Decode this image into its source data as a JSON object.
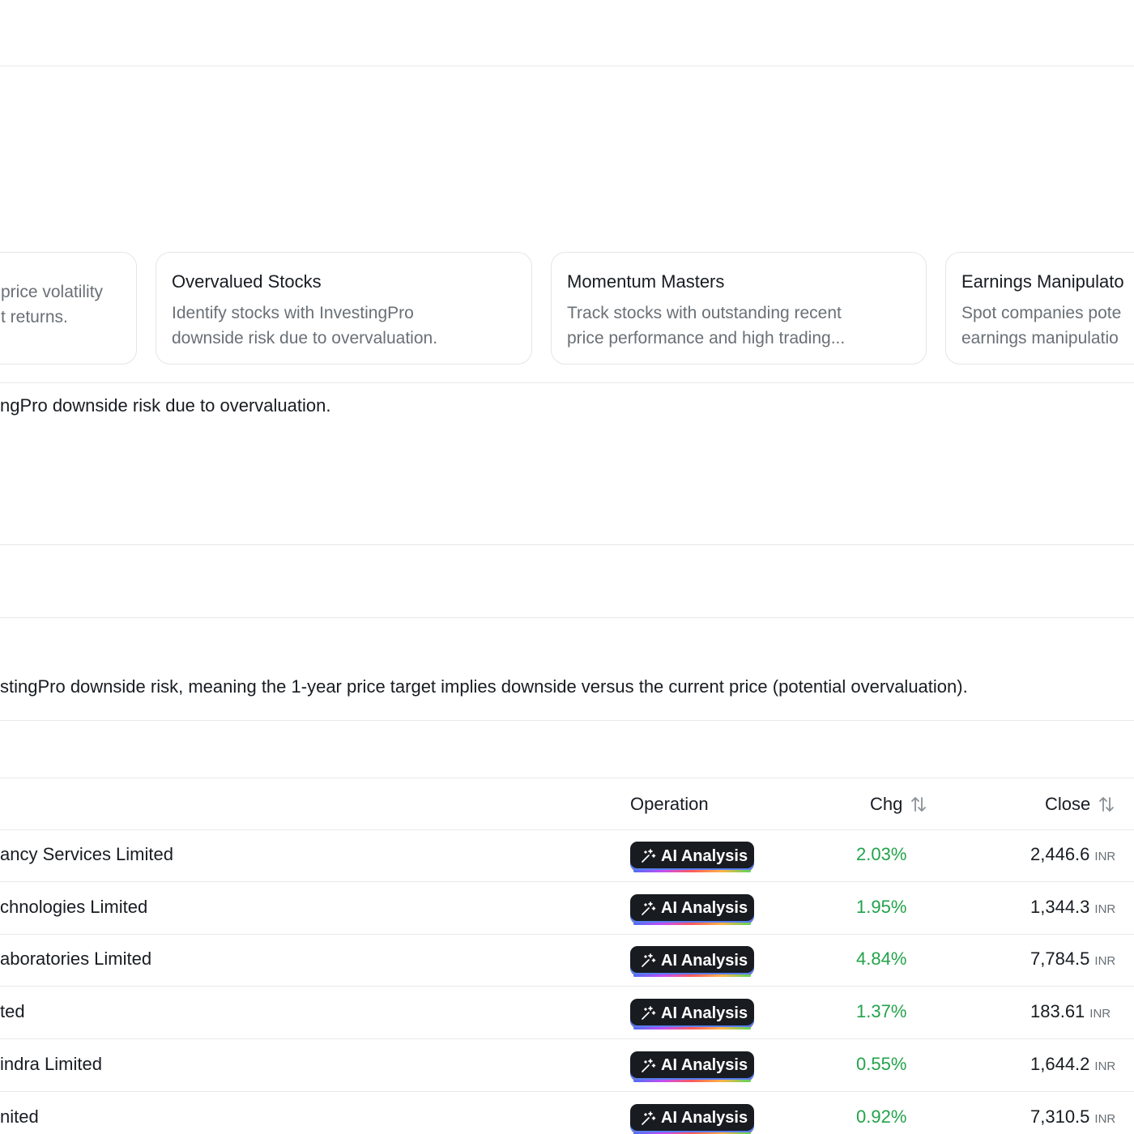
{
  "cards": [
    {
      "title": "",
      "desc_lines": [
        "price volatility",
        "t returns."
      ]
    },
    {
      "title": "Overvalued Stocks",
      "desc_lines": [
        "Identify stocks with InvestingPro",
        "downside risk due to overvaluation."
      ]
    },
    {
      "title": "Momentum Masters",
      "desc_lines": [
        "Track stocks with outstanding recent",
        "price performance and high trading..."
      ]
    },
    {
      "title": "Earnings Manipulato",
      "desc_lines": [
        "Spot companies pote",
        "earnings manipulatio"
      ]
    }
  ],
  "short_description": "ngPro downside risk due to overvaluation.",
  "long_description": "stingPro downside risk, meaning the 1-year price target implies downside versus the current price (potential overvaluation).",
  "table": {
    "headers": {
      "operation": "Operation",
      "chg": "Chg",
      "close": "Close"
    },
    "button_label": "AI Analysis",
    "rows": [
      {
        "name": "ancy Services Limited",
        "chg": "2.03%",
        "close": "2,446.6",
        "currency": "INR"
      },
      {
        "name": "chnologies Limited",
        "chg": "1.95%",
        "close": "1,344.3",
        "currency": "INR"
      },
      {
        "name": "aboratories Limited",
        "chg": "4.84%",
        "close": "7,784.5",
        "currency": "INR"
      },
      {
        "name": "ted",
        "chg": "1.37%",
        "close": "183.61",
        "currency": "INR"
      },
      {
        "name": "indra Limited",
        "chg": "0.55%",
        "close": "1,644.2",
        "currency": "INR"
      },
      {
        "name": "nited",
        "chg": "0.92%",
        "close": "7,310.5",
        "currency": "INR"
      }
    ]
  },
  "colors": {
    "positive": "#22a34a",
    "button_bg": "#181c21",
    "border": "#e6e9eb"
  }
}
